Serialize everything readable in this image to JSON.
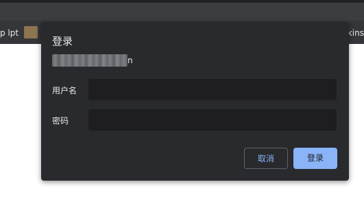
{
  "browser": {
    "bookmark_left": "p lpt",
    "bookmark_right": "nkins"
  },
  "dialog": {
    "title": "登录",
    "origin_visible_tail": "n",
    "username_label": "用户名",
    "username_value": "",
    "password_label": "密码",
    "password_value": "",
    "cancel_label": "取消",
    "login_label": "登录"
  },
  "colors": {
    "dialog_bg": "#292a2d",
    "field_bg": "#1e1e20",
    "accent": "#8ab4f8",
    "text": "#e8eaed"
  }
}
